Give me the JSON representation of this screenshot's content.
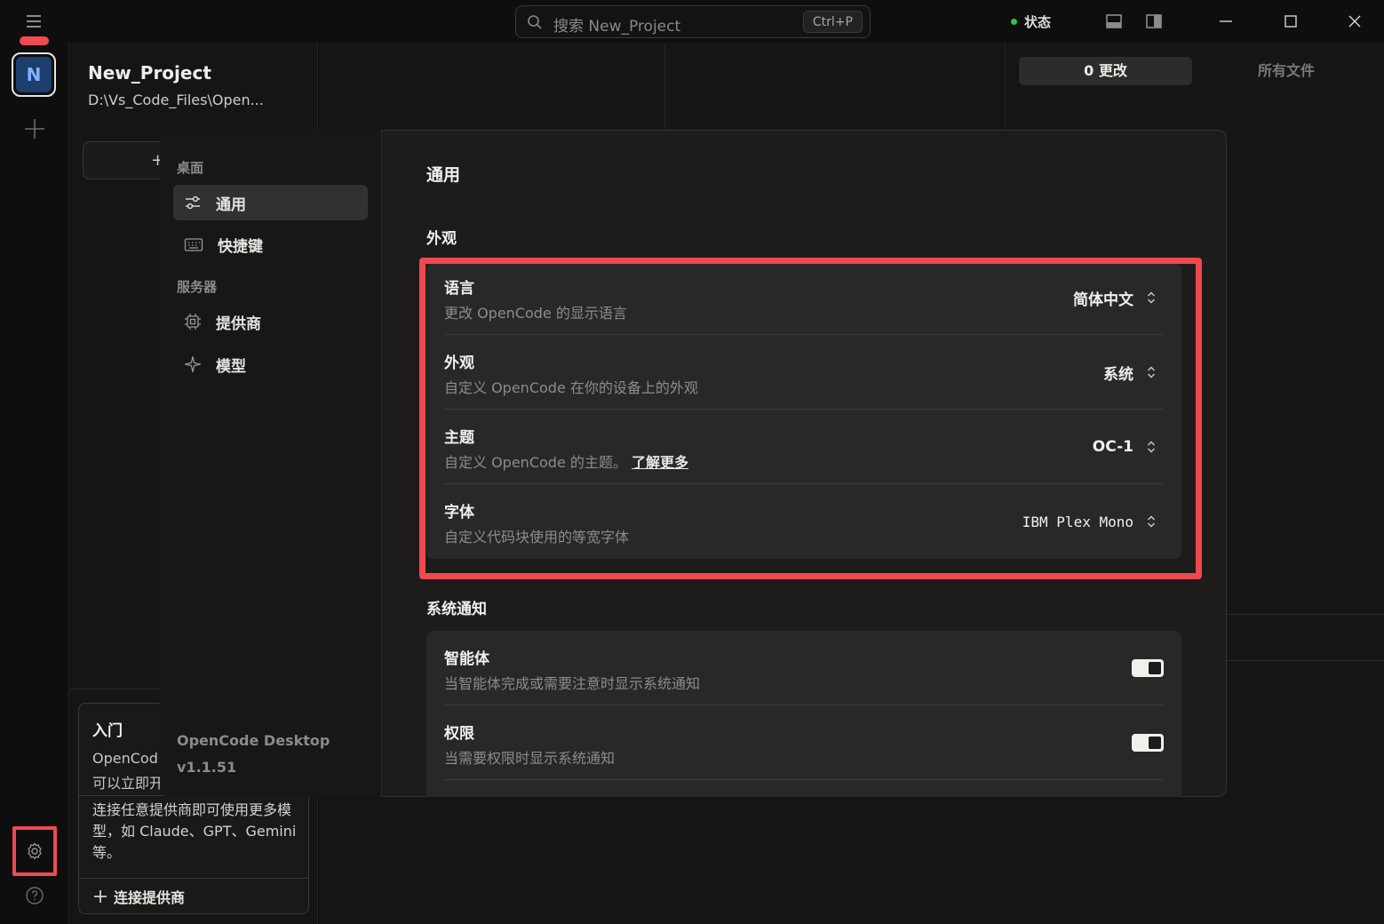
{
  "search": {
    "placeholder": "搜索 New_Project",
    "shortcut": "Ctrl+P"
  },
  "status": {
    "label": "状态",
    "color": "#36c24a"
  },
  "project": {
    "avatar_letter": "N",
    "name": "New_Project",
    "path": "D:\\Vs_Code_Files\\Open..."
  },
  "new_session": {
    "label": "+"
  },
  "getting_started": {
    "title": "入门",
    "line1": "OpenCod",
    "line2": "可以立即开",
    "description": "连接任意提供商即可使用更多模型，如 Claude、GPT、Gemini 等。",
    "connect_label": "连接提供商"
  },
  "review_tabs": {
    "changes": "0 更改",
    "all_files": "所有文件"
  },
  "settings": {
    "nav": {
      "group_desktop": "桌面",
      "general": "通用",
      "shortcuts": "快捷键",
      "group_server": "服务器",
      "providers": "提供商",
      "models": "模型"
    },
    "footer": {
      "app": "OpenCode Desktop",
      "version": "v1.1.51"
    },
    "title": "通用",
    "appearance": {
      "heading": "外观",
      "language": {
        "title": "语言",
        "desc": "更改 OpenCode 的显示语言",
        "value": "简体中文"
      },
      "appearance": {
        "title": "外观",
        "desc": "自定义 OpenCode 在你的设备上的外观",
        "value": "系统"
      },
      "theme": {
        "title": "主题",
        "desc": "自定义 OpenCode 的主题。",
        "link": "了解更多",
        "value": "OC-1"
      },
      "font": {
        "title": "字体",
        "desc": "自定义代码块使用的等宽字体",
        "value": "IBM Plex Mono"
      }
    },
    "notifications": {
      "heading": "系统通知",
      "agent": {
        "title": "智能体",
        "desc": "当智能体完成或需要注意时显示系统通知",
        "enabled": true
      },
      "permission": {
        "title": "权限",
        "desc": "当需要权限时显示系统通知",
        "enabled": true
      }
    }
  },
  "colors": {
    "accent_highlight": "#f04a52",
    "project_avatar": "#1c3f6e"
  }
}
